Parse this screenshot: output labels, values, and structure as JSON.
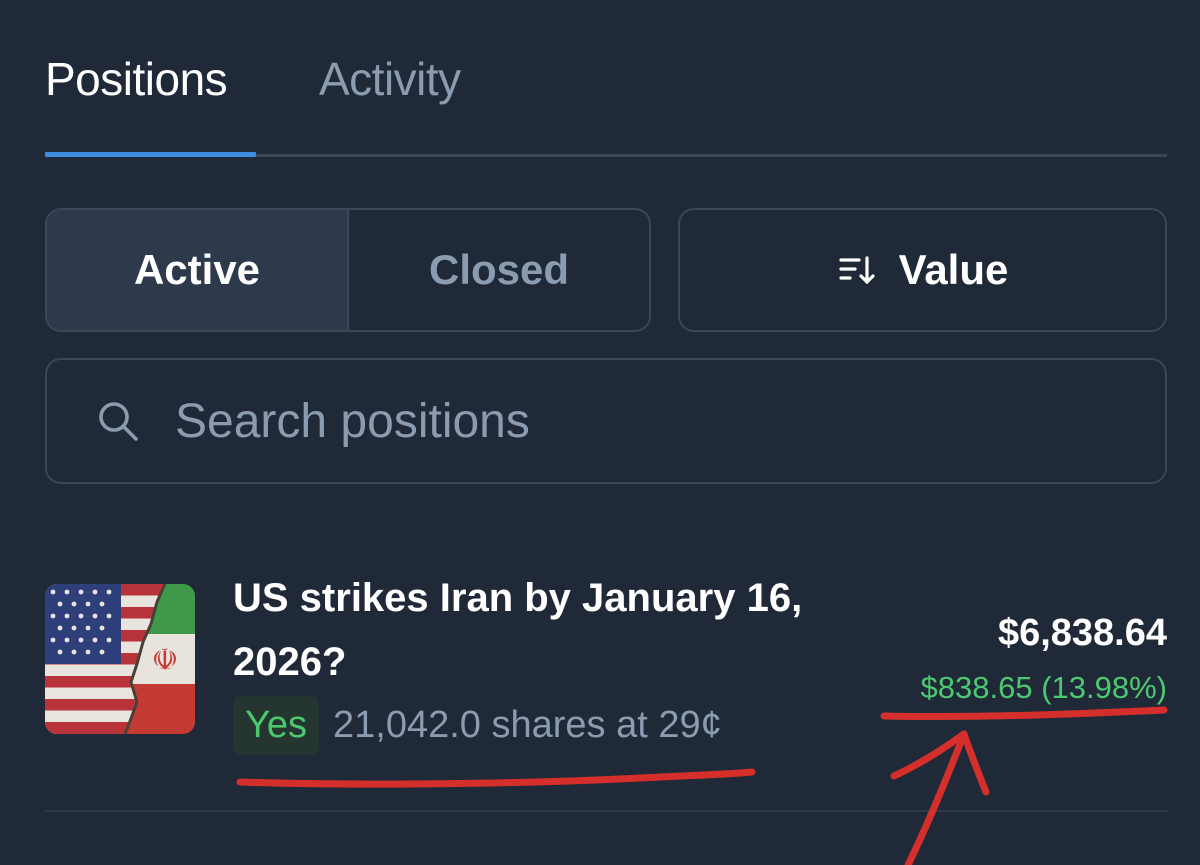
{
  "tabs": {
    "positions_label": "Positions",
    "activity_label": "Activity"
  },
  "filters": {
    "active_label": "Active",
    "closed_label": "Closed",
    "sort_label": "Value",
    "sort_icon": "sort-descending-icon"
  },
  "search": {
    "placeholder": "Search positions",
    "icon": "search-icon"
  },
  "position": {
    "title": "US strikes Iran by January 16, 2026?",
    "outcome": "Yes",
    "shares_text": "21,042.0 shares at 29¢",
    "value": "$6,838.64",
    "pnl": "$838.65 (13.98%)",
    "thumbnail": "us-iran-flags-image"
  },
  "colors": {
    "background": "#1f2937",
    "accent": "#3b8ee0",
    "positive": "#4cc970",
    "muted": "#8b9bb0",
    "annotation": "#d42f2a"
  }
}
